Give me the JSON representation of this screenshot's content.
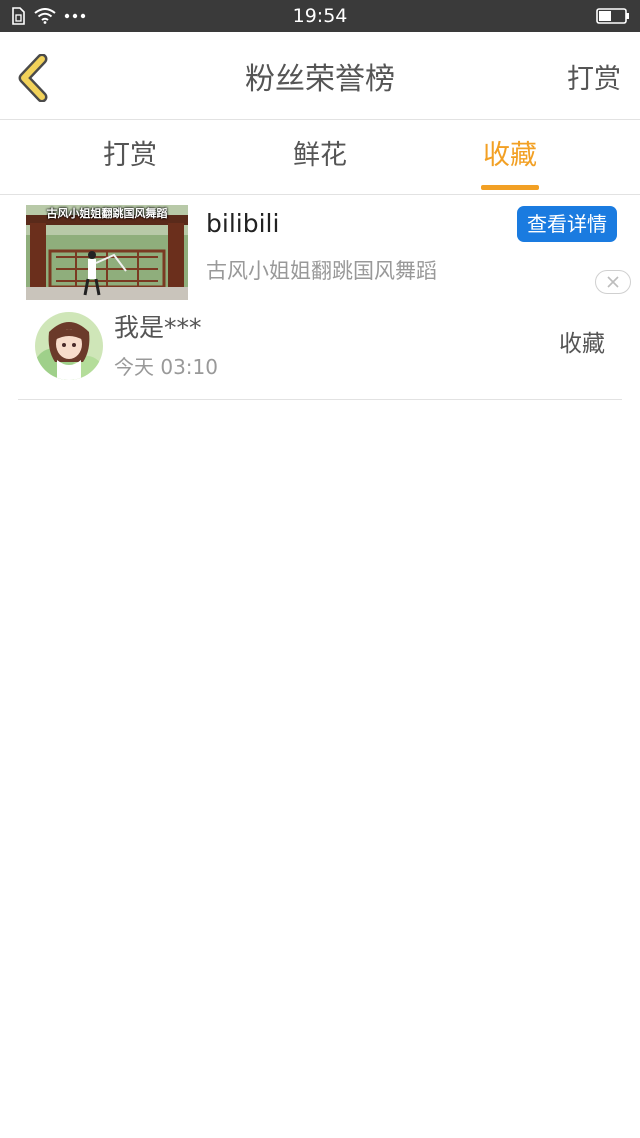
{
  "status_bar": {
    "time": "19:54",
    "icons": [
      "sim-icon",
      "wifi-icon",
      "more-dots-icon",
      "battery-icon"
    ]
  },
  "nav": {
    "back_icon": "chevron-left-icon",
    "title": "粉丝荣誉榜",
    "action": "打赏"
  },
  "tabs": [
    {
      "label": "打赏",
      "active": false
    },
    {
      "label": "鲜花",
      "active": false
    },
    {
      "label": "收藏",
      "active": true
    }
  ],
  "colors": {
    "accent": "#f2a024",
    "button_blue": "#1a7be0",
    "status_bar": "#3a3a3a",
    "text_primary": "#555555",
    "text_secondary": "#999999"
  },
  "ad": {
    "thumbnail_caption": "古风小姐姐翻跳国风舞蹈",
    "source": "bilibili",
    "description": "古风小姐姐翻跳国风舞蹈",
    "detail_button": "查看详情",
    "close_icon": "close-icon"
  },
  "list": [
    {
      "name": "我是***",
      "time": "今天 03:10",
      "action": "收藏"
    }
  ]
}
